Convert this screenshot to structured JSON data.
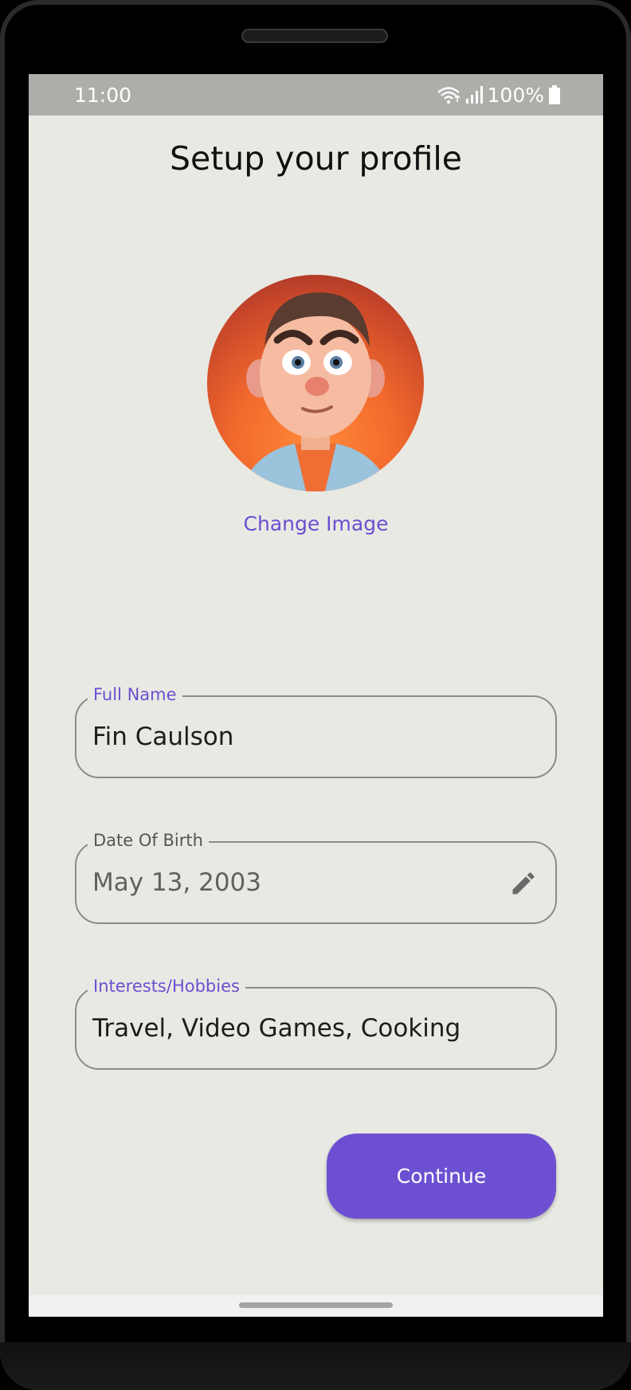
{
  "status_bar": {
    "time": "11:00",
    "battery": "100%",
    "icons": [
      "wifi-icon",
      "signal-icon",
      "battery-icon"
    ]
  },
  "page": {
    "title": "Setup your profile"
  },
  "avatar": {
    "icon": "avatar-cartoon-man"
  },
  "change_image_label": "Change Image",
  "form": {
    "full_name": {
      "label": "Full Name",
      "value": "Fin Caulson"
    },
    "date_of_birth": {
      "label": "Date Of Birth",
      "value": "May 13, 2003",
      "icon": "pencil-edit-icon"
    },
    "interests": {
      "label": "Interests/Hobbies",
      "value": "Travel, Video Games, Cooking"
    }
  },
  "continue_label": "Continue",
  "colors": {
    "accent": "#6d50d1",
    "background": "#e9e9e4",
    "status_bar": "#adadaa"
  }
}
